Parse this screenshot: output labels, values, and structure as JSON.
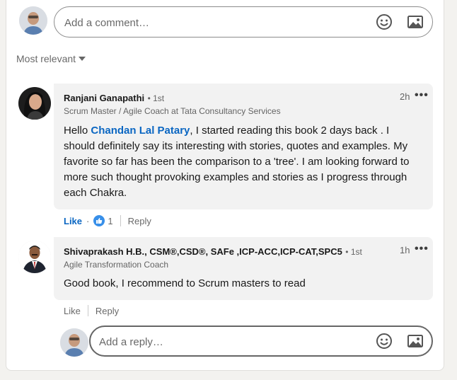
{
  "comment_box": {
    "placeholder": "Add a comment…"
  },
  "sort": {
    "label": "Most relevant"
  },
  "comments": [
    {
      "author": "Ranjani Ganapathi",
      "degree": "• 1st",
      "headline": "Scrum Master / Agile Coach at Tata Consultancy Services",
      "time": "2h",
      "more": "•••",
      "text_before": "Hello ",
      "mention": "Chandan Lal Patary",
      "text_after": ", I started reading this book 2 days back . I should definitely say its interesting with stories, quotes and examples. My favorite so far has been the comparison to a 'tree'. I am looking forward to more such thought provoking examples and stories as I progress through each Chakra.",
      "like_label": "Like",
      "reaction_count": "1",
      "reply_label": "Reply"
    },
    {
      "author": "Shivaprakash H.B., CSM®,CSD®, SAFe ,ICP-ACC,ICP-CAT,SPC5",
      "degree": "• 1st",
      "headline": "Agile Transformation Coach",
      "time": "1h",
      "more": "•••",
      "text": "Good book, I recommend to Scrum masters to read",
      "like_label": "Like",
      "reply_label": "Reply"
    }
  ],
  "reply_box": {
    "placeholder": "Add a reply…"
  },
  "colors": {
    "accent": "#0a66c2",
    "bubble": "#f2f2f2",
    "background": "#f3f2ef"
  },
  "icons": [
    "emoji-icon",
    "image-icon",
    "caret-down-icon",
    "thumbs-up-icon",
    "more-options-icon"
  ]
}
